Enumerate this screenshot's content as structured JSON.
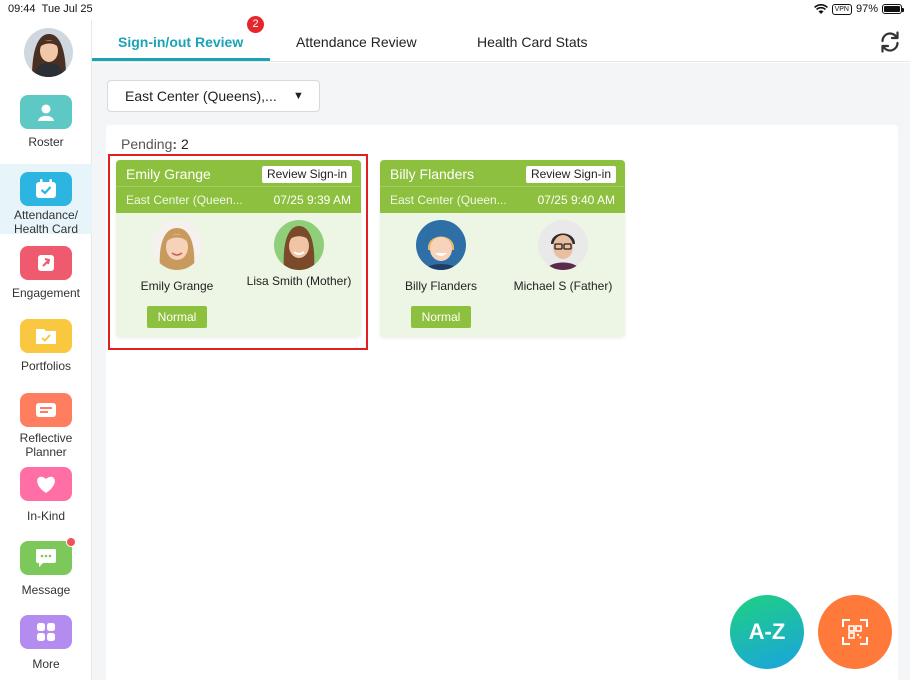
{
  "status_bar": {
    "time": "09:44",
    "date": "Tue Jul 25",
    "vpn": "VPN",
    "battery": "97%",
    "battery_level": 0.97
  },
  "sidebar": {
    "items": [
      {
        "label": "Roster",
        "icon": "roster-icon",
        "color": "#5ec8c4"
      },
      {
        "label": "Attendance/ Health Card",
        "icon": "calendar-check-icon",
        "color": "#2bb5e0",
        "active": true
      },
      {
        "label": "Engagement",
        "icon": "engagement-icon",
        "color": "#f05a6e"
      },
      {
        "label": "Portfolios",
        "icon": "portfolio-icon",
        "color": "#f9c840"
      },
      {
        "label": "Reflective Planner",
        "icon": "planner-icon",
        "color": "#ff7e5f"
      },
      {
        "label": "In-Kind",
        "icon": "heart-icon",
        "color": "#ff6fa6"
      },
      {
        "label": "Message",
        "icon": "message-icon",
        "color": "#7dc85a",
        "has_dot": true
      },
      {
        "label": "More",
        "icon": "grid-icon",
        "color": "#b48cf0"
      }
    ]
  },
  "tabs": {
    "items": [
      {
        "label": "Sign-in/out Review",
        "active": true,
        "badge": "2"
      },
      {
        "label": "Attendance Review"
      },
      {
        "label": "Health Card Stats"
      }
    ]
  },
  "filter": {
    "center": "East Center (Queens),...",
    "caret": "▼"
  },
  "pending": {
    "label": "Pending",
    "sep": ":",
    "count": "2"
  },
  "cards": [
    {
      "child": "Emily Grange",
      "action": "Review Sign-in",
      "center": "East Center (Queen...",
      "datetime": "07/25 9:39 AM",
      "child_label": "Emily Grange",
      "guardian": "Lisa Smith (Mother)",
      "status": "Normal"
    },
    {
      "child": "Billy Flanders",
      "action": "Review Sign-in",
      "center": "East Center (Queen...",
      "datetime": "07/25 9:40 AM",
      "child_label": "Billy Flanders",
      "guardian": "Michael S (Father)",
      "status": "Normal"
    }
  ],
  "fabs": {
    "az": "A-Z",
    "scan": "qr-scan-icon"
  },
  "colors": {
    "accent": "#1aa3b5",
    "card_green": "#8dc03e",
    "badge_red": "#e5262d",
    "highlight_red": "#e02020"
  }
}
